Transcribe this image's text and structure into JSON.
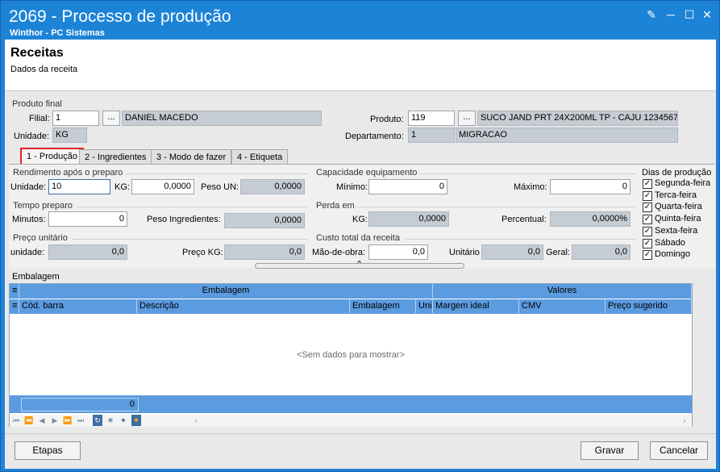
{
  "window": {
    "title": "2069 - Processo de produção",
    "subtitle": "Winthor - PC Sistemas"
  },
  "header": {
    "title": "Receitas",
    "subtitle": "Dados da receita"
  },
  "produto_final": {
    "group_label": "Produto final",
    "filial_label": "Filial:",
    "filial_value": "1",
    "filial_desc": "DANIEL MACEDO",
    "unidade_label": "Unidade:",
    "unidade_value": "KG",
    "produto_label": "Produto:",
    "produto_value": "119",
    "produto_desc": "SUCO JAND PRT 24X200ML TP - CAJU 1234567",
    "departamento_label": "Departamento:",
    "departamento_value": "1",
    "departamento_desc": "MIGRACAO",
    "dots": "..."
  },
  "tabs": [
    {
      "label": "1 - Produção"
    },
    {
      "label": "2 - Ingredientes"
    },
    {
      "label": "3 - Modo de fazer"
    },
    {
      "label": "4 - Etiqueta"
    }
  ],
  "producao": {
    "rendimento": {
      "title": "Rendimento após o preparo",
      "unidade_label": "Unidade:",
      "unidade_value": "10",
      "kg_label": "KG:",
      "kg_value": "0,0000",
      "peso_un_label": "Peso UN:",
      "peso_un_value": "0,0000"
    },
    "tempo": {
      "title": "Tempo preparo",
      "minutos_label": "Minutos:",
      "minutos_value": "0",
      "peso_ing_label": "Peso Ingredientes:",
      "peso_ing_value": "0,0000"
    },
    "preco": {
      "title": "Preço unitário",
      "unidade_label": "unidade:",
      "unidade_value": "0,0",
      "preco_kg_label": "Preço KG:",
      "preco_kg_value": "0,0"
    },
    "capacidade": {
      "title": "Capacidade equipamento",
      "minimo_label": "Mínimo:",
      "minimo_value": "0",
      "maximo_label": "Máximo:",
      "maximo_value": "0"
    },
    "perda": {
      "title": "Perda em",
      "kg_label": "KG:",
      "kg_value": "0,0000",
      "percentual_label": "Percentual:",
      "percentual_value": "0,0000%"
    },
    "custo": {
      "title": "Custo total da receita",
      "mao_label": "Mão-de-obra:",
      "mao_value": "0,0",
      "unitario_label": "Unitário",
      "unitario_value": "0,0",
      "geral_label": "Geral:",
      "geral_value": "0,0"
    },
    "dias": {
      "title": "Dias de produção",
      "items": [
        "Segunda-feira",
        "Terca-feira",
        "Quarta-feira",
        "Quinta-feira",
        "Sexta-feira",
        "Sábado",
        "Domingo"
      ]
    }
  },
  "embalagem": {
    "group_label": "Embalagem",
    "band_embalagem": "Embalagem",
    "band_valores": "Valores",
    "columns": [
      "Cód. barra",
      "Descrição",
      "Embalagem",
      "Uni",
      "Margem ideal",
      "CMV",
      "Preço sugerido"
    ],
    "empty_text": "<Sem dados para mostrar>",
    "footer_count": "0"
  },
  "buttons": {
    "etapas": "Etapas",
    "gravar": "Gravar",
    "cancelar": "Cancelar"
  }
}
